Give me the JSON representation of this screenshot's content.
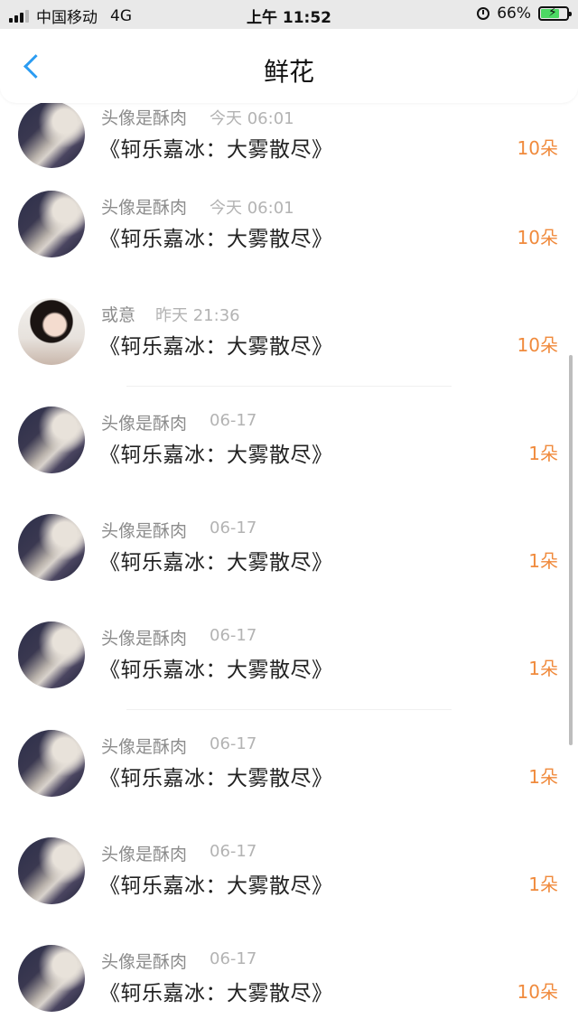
{
  "status_bar": {
    "carrier": "中国移动",
    "network": "4G",
    "time": "上午 11:52",
    "battery_percent": "66%",
    "battery_level": 0.66,
    "battery_color": "#4cd964"
  },
  "nav": {
    "title": "鲜花",
    "back_icon": "chevron-left-icon",
    "accent_color": "#2b9cf2"
  },
  "items": [
    {
      "name": "头像是酥肉",
      "time": "今天 06:01",
      "book": "《轲乐嘉冰：大雾散尽》",
      "count": "10朵",
      "avatar": "dark-hair-avatar"
    },
    {
      "name": "头像是酥肉",
      "time": "今天 06:01",
      "book": "《轲乐嘉冰：大雾散尽》",
      "count": "10朵",
      "avatar": "dark-hair-avatar"
    },
    {
      "name": "或意",
      "time": "昨天 21:36",
      "book": "《轲乐嘉冰：大雾散尽》",
      "count": "10朵",
      "avatar": "girl-portrait-avatar"
    },
    {
      "name": "头像是酥肉",
      "time": "06-17",
      "book": "《轲乐嘉冰：大雾散尽》",
      "count": "1朵",
      "avatar": "dark-hair-avatar"
    },
    {
      "name": "头像是酥肉",
      "time": "06-17",
      "book": "《轲乐嘉冰：大雾散尽》",
      "count": "1朵",
      "avatar": "dark-hair-avatar"
    },
    {
      "name": "头像是酥肉",
      "time": "06-17",
      "book": "《轲乐嘉冰：大雾散尽》",
      "count": "1朵",
      "avatar": "dark-hair-avatar"
    },
    {
      "name": "头像是酥肉",
      "time": "06-17",
      "book": "《轲乐嘉冰：大雾散尽》",
      "count": "1朵",
      "avatar": "dark-hair-avatar"
    },
    {
      "name": "头像是酥肉",
      "time": "06-17",
      "book": "《轲乐嘉冰：大雾散尽》",
      "count": "1朵",
      "avatar": "dark-hair-avatar"
    },
    {
      "name": "头像是酥肉",
      "time": "06-17",
      "book": "《轲乐嘉冰：大雾散尽》",
      "count": "10朵",
      "avatar": "dark-hair-avatar"
    }
  ],
  "count_color": "#f08a3c"
}
